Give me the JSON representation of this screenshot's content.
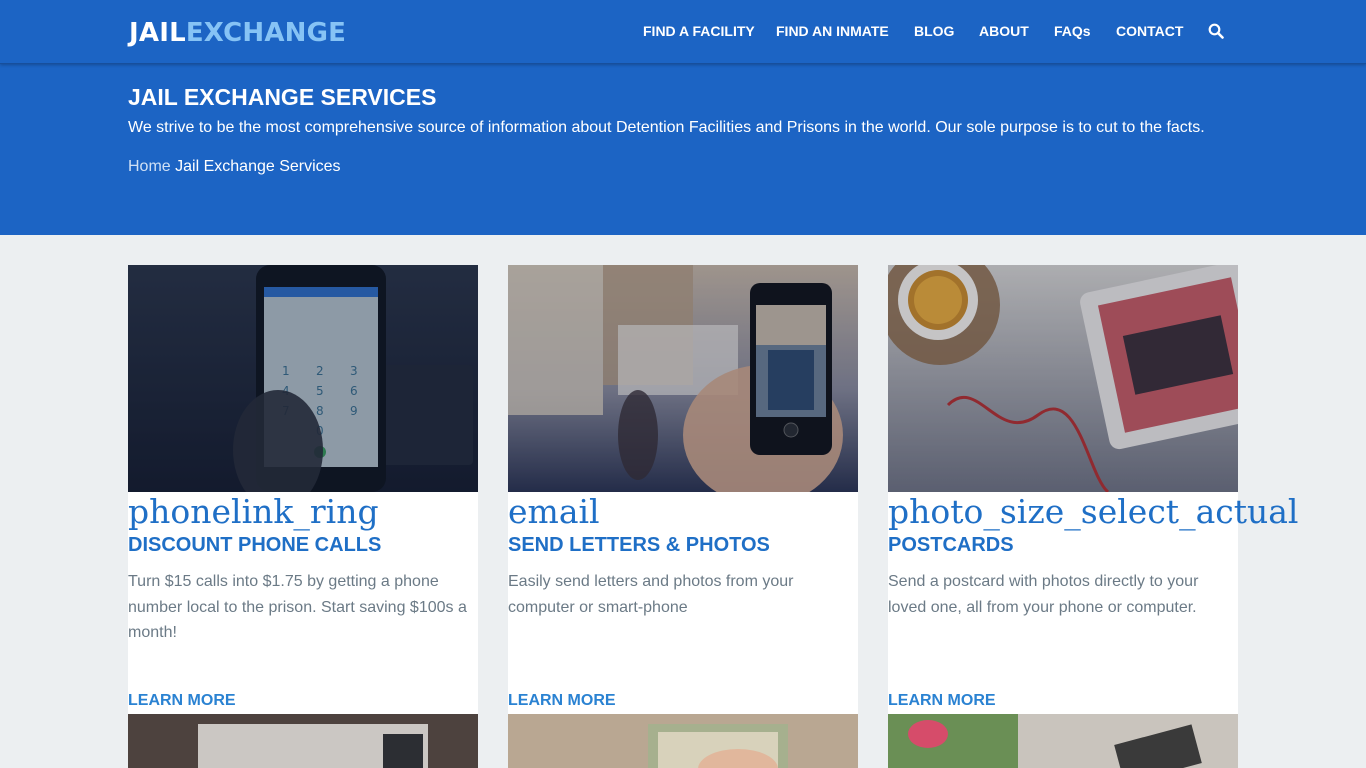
{
  "header": {
    "logo_part1": "JAIL",
    "logo_part2": "EXCHANGE",
    "nav": [
      {
        "label": "FIND A FACILITY"
      },
      {
        "label": "FIND AN INMATE"
      },
      {
        "label": "BLOG"
      },
      {
        "label": "ABOUT"
      },
      {
        "label": "FAQs"
      },
      {
        "label": "CONTACT"
      }
    ],
    "search_icon": "search-icon"
  },
  "hero": {
    "title": "JAIL EXCHANGE SERVICES",
    "description": "We strive to be the most comprehensive source of information about Detention Facilities and Prisons in the world. Our sole purpose is to cut to the facts.",
    "breadcrumb_home": "Home",
    "breadcrumb_current": "Jail Exchange Services"
  },
  "cards": [
    {
      "icon_text": "phonelink_ring",
      "heading": "DISCOUNT PHONE CALLS",
      "text": "Turn $15 calls into $1.75 by getting a phone number local to the prison. Start saving $100s a month!",
      "link": "LEARN MORE"
    },
    {
      "icon_text": "email",
      "heading": "SEND LETTERS & PHOTOS",
      "text": "Easily send letters and photos from your computer or smart-phone",
      "link": "LEARN MORE"
    },
    {
      "icon_text": "photo_size_select_actual",
      "heading": "POSTCARDS",
      "text": "Send a postcard with photos directly to your loved one, all from your phone or computer.",
      "link": "LEARN MORE"
    }
  ],
  "colors": {
    "brand_blue": "#1c64c4",
    "logo_accent": "#86c3f5",
    "link_blue": "#2a82d2",
    "page_bg": "#eceff1"
  }
}
